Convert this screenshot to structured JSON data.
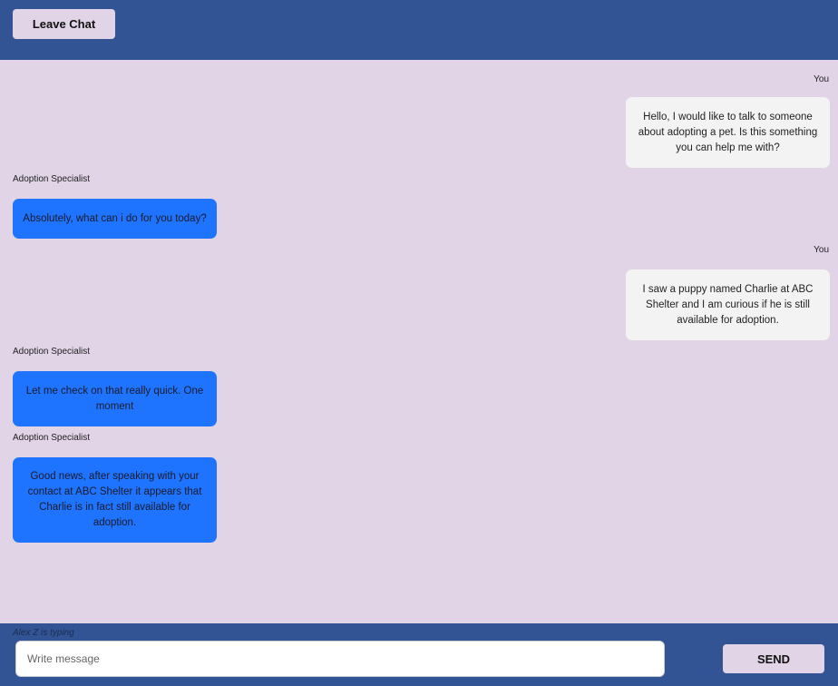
{
  "header": {
    "leave_label": "Leave Chat"
  },
  "messages": [
    {
      "sender": "You",
      "text": "Hello, I would like to talk to someone about adopting a pet. Is this something you can help me with?"
    },
    {
      "sender": "Adoption Specialist",
      "text": "Absolutely, what can i do for you today?"
    },
    {
      "sender": "You",
      "text": "I saw a puppy named Charlie at ABC Shelter and I am curious if he is still available for adoption."
    },
    {
      "sender": "Adoption Specialist",
      "text": "Let me check on that really quick. One moment"
    },
    {
      "sender": "Adoption Specialist",
      "text": "Good news, after speaking with your contact at ABC Shelter it appears that Charlie is in fact still available for adoption."
    }
  ],
  "footer": {
    "typing_indicator": "Alex Z is typing",
    "input_placeholder": "Write message",
    "input_value": "",
    "send_label": "SEND"
  },
  "colors": {
    "header_bg": "#325394",
    "chat_bg": "#E0D4E6",
    "user_bubble": "#F3F3F3",
    "agent_bubble": "#1F74FF",
    "button_bg": "#E0D4E6"
  }
}
